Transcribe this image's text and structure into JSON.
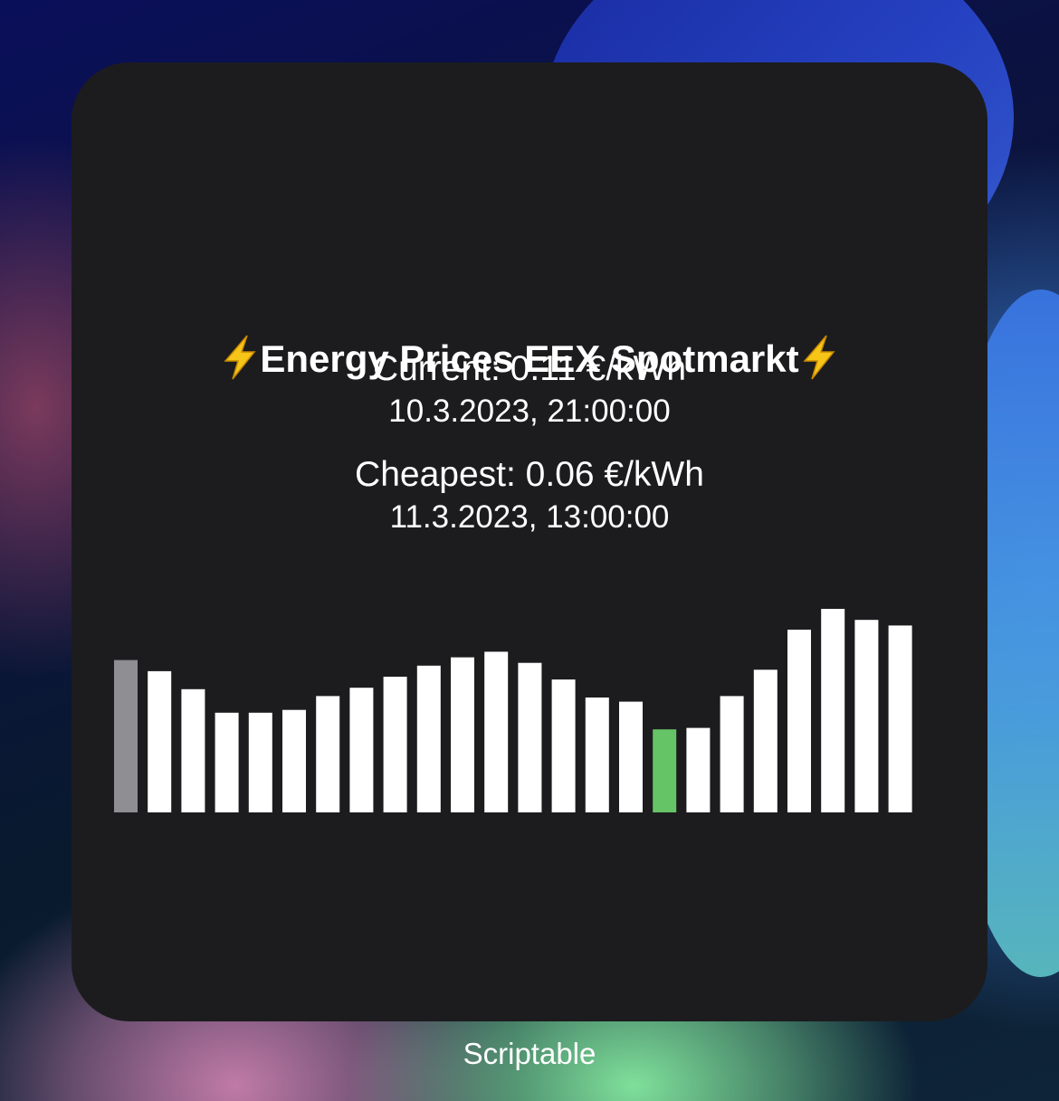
{
  "widget": {
    "title": "Energy Prices EEX Spotmarkt",
    "title_icon": "lightning-bolt-icon",
    "current_label": "Current: 0.11 €/kWh",
    "current_time": "10.3.2023, 21:00:00",
    "cheapest_label": "Cheapest: 0.06 €/kWh",
    "cheapest_time": "11.3.2023, 13:00:00"
  },
  "chart_data": {
    "type": "bar",
    "values": [
      0.11,
      0.102,
      0.089,
      0.072,
      0.072,
      0.074,
      0.084,
      0.09,
      0.098,
      0.106,
      0.112,
      0.116,
      0.108,
      0.096,
      0.083,
      0.08,
      0.06,
      0.061,
      0.084,
      0.103,
      0.132,
      0.147,
      0.139,
      0.135
    ],
    "current_index": 0,
    "cheapest_index": 16,
    "colors": {
      "current": "#8e8e93",
      "cheapest": "#65c466",
      "default": "#ffffff"
    }
  },
  "app_label": "Scriptable"
}
